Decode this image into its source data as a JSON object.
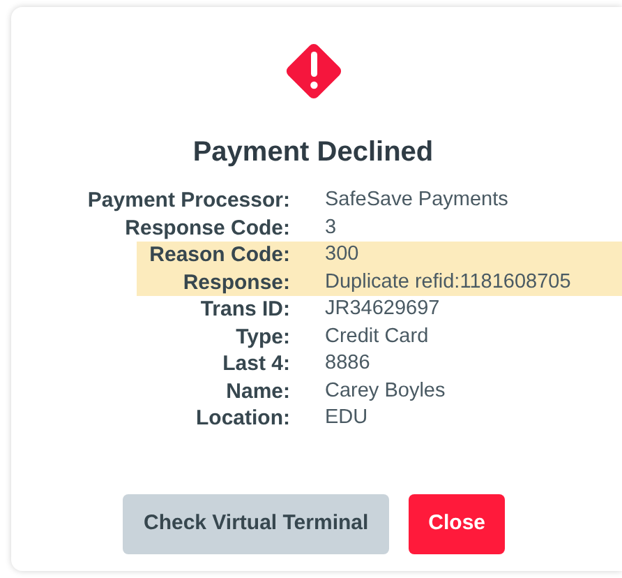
{
  "dialog": {
    "title": "Payment Declined",
    "details": [
      {
        "label": "Payment Processor:",
        "value": "SafeSave Payments",
        "highlighted": false
      },
      {
        "label": "Response Code:",
        "value": "3",
        "highlighted": false
      },
      {
        "label": "Reason Code:",
        "value": "300",
        "highlighted": true
      },
      {
        "label": "Response:",
        "value": "Duplicate refid:1181608705",
        "highlighted": true
      },
      {
        "label": "Trans ID:",
        "value": "JR34629697",
        "highlighted": false
      },
      {
        "label": "Type:",
        "value": "Credit Card",
        "highlighted": false
      },
      {
        "label": "Last 4:",
        "value": "8886",
        "highlighted": false
      },
      {
        "label": "Name:",
        "value": "Carey Boyles",
        "highlighted": false
      },
      {
        "label": "Location:",
        "value": "EDU",
        "highlighted": false
      }
    ],
    "buttons": [
      {
        "label": "Check Virtual Terminal",
        "kind": "secondary"
      },
      {
        "label": "Close",
        "kind": "danger"
      }
    ]
  }
}
